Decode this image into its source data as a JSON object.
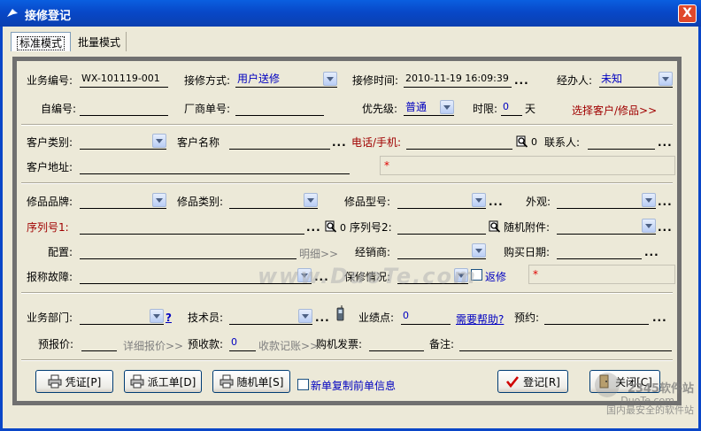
{
  "window": {
    "title": "接修登记",
    "close": "X"
  },
  "tabs": [
    {
      "label": "标准模式"
    },
    {
      "label": "批量模式"
    }
  ],
  "row1": {
    "business_no_label": "业务编号:",
    "business_no_value": "WX-101119-001",
    "method_label": "接修方式:",
    "method_value": "用户送修",
    "time_label": "接修时间:",
    "time_value": "2010-11-19 16:09:39",
    "handler_label": "经办人:",
    "handler_value": "未知"
  },
  "row2": {
    "self_no_label": "自编号:",
    "vendor_no_label": "厂商单号:",
    "priority_label": "优先级:",
    "priority_value": "普通",
    "limit_label": "时限:",
    "limit_value": "0",
    "limit_unit": "天",
    "select_link": "选择客户/修品>>"
  },
  "customer": {
    "type_label": "客户类别:",
    "name_label": "客户名称",
    "phone_label": "电话/手机:",
    "phone_count": "0",
    "contact_label": "联系人:",
    "address_label": "客户地址:",
    "required_mark": "*"
  },
  "product": {
    "brand_label": "修品品牌:",
    "category_label": "修品类别:",
    "model_label": "修品型号:",
    "appearance_label": "外观:",
    "serial1_label": "序列号1:",
    "serial1_count": "0",
    "serial2_label": "序列号2:",
    "serial2_count": "0",
    "accessory_label": "随机附件:",
    "config_label": "配置:",
    "detail_link": "明细>>",
    "dealer_label": "经销商:",
    "purchase_date_label": "购买日期:",
    "fault_label": "报称故障:",
    "warranty_label": "保修情况:",
    "return_label": "返修",
    "required_mark": "*"
  },
  "business": {
    "dept_label": "业务部门:",
    "help_mark": "?",
    "tech_label": "技术员:",
    "points_label": "业绩点:",
    "points_value": "0",
    "need_help_link": "需要帮助?",
    "appointment_label": "预约:",
    "quote_label": "预报价:",
    "quote_detail_link": "详细报价>>",
    "prepay_label": "预收款:",
    "prepay_value": "0",
    "prepay_link": "收款记账>>",
    "invoice_label": "购机发票:",
    "remark_label": "备注:"
  },
  "buttons": {
    "voucher": "凭证[P]",
    "dispatch": "派工单[D]",
    "random": "随机单[S]",
    "copy_prev": "新单复制前单信息",
    "register": "登记[R]",
    "close": "关闭[C]"
  },
  "watermark": {
    "center": "www.DuoTe.com",
    "corner_name": "2345软件站",
    "corner_site": "DuoTe.com",
    "corner_slogan": "国内最安全的软件站"
  }
}
